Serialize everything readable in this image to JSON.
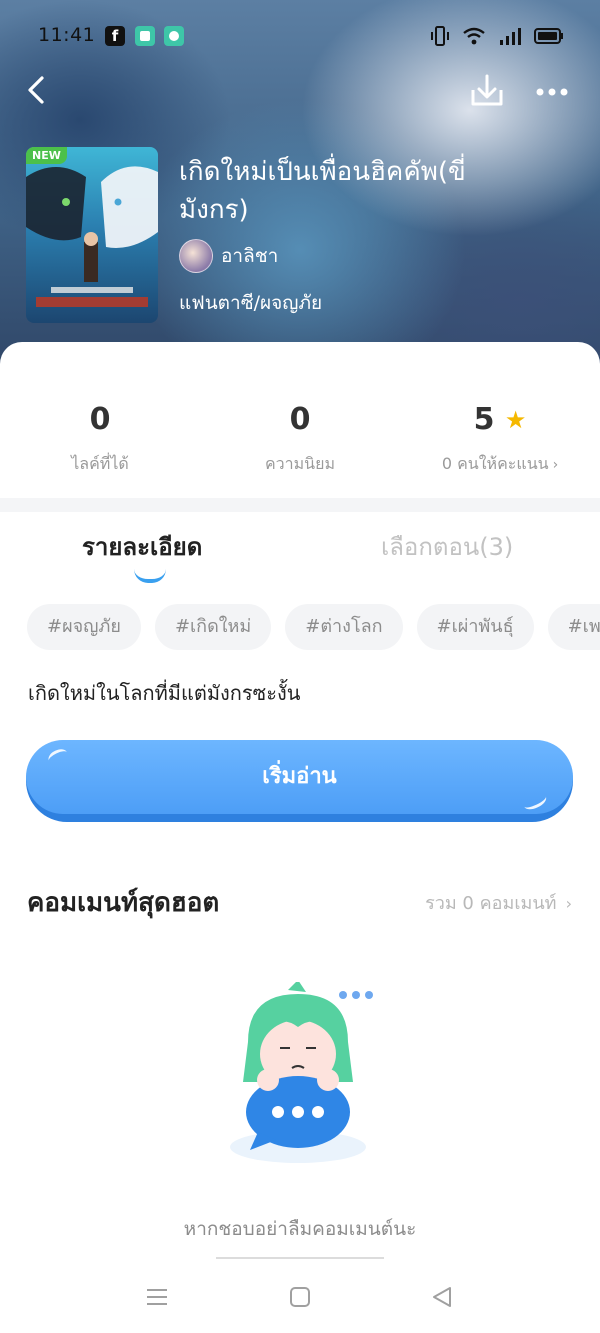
{
  "status_bar": {
    "time": "11:41",
    "apps": [
      "facebook-icon",
      "messenger-icon",
      "chat-icon"
    ]
  },
  "header": {
    "badge": "NEW",
    "title": "เกิดใหม่เป็นเพื่อนฮิคคัพ(ขี่มังกร)",
    "author": "อาลิชา",
    "genre": "แฟนตาซี/ผจญภัย"
  },
  "stats": [
    {
      "value": "0",
      "label": "ไลค์ที่ได้"
    },
    {
      "value": "0",
      "label": "ความนิยม"
    },
    {
      "value": "5",
      "label": "0 คนให้คะแนน"
    }
  ],
  "tabs": {
    "detail": "รายละเอียด",
    "episodes": "เลือกตอน(3)"
  },
  "tags": [
    "#ผจญภัย",
    "#เกิดใหม่",
    "#ต่างโลก",
    "#เผ่าพันธุ์",
    "#เพ"
  ],
  "description": "เกิดใหม่ในโลกที่มีแต่มังกรซะงั้น",
  "read_button": "เริ่มอ่าน",
  "comments": {
    "heading": "คอมเมนท์สุดฮอต",
    "count_label": "รวม 0 คอมเมนท์",
    "empty_text": "หากชอบอย่าลืมคอมเมนต์นะ"
  },
  "colors": {
    "accent": "#4d9ef6",
    "star": "#f5b800",
    "badge": "#4cc04a"
  }
}
